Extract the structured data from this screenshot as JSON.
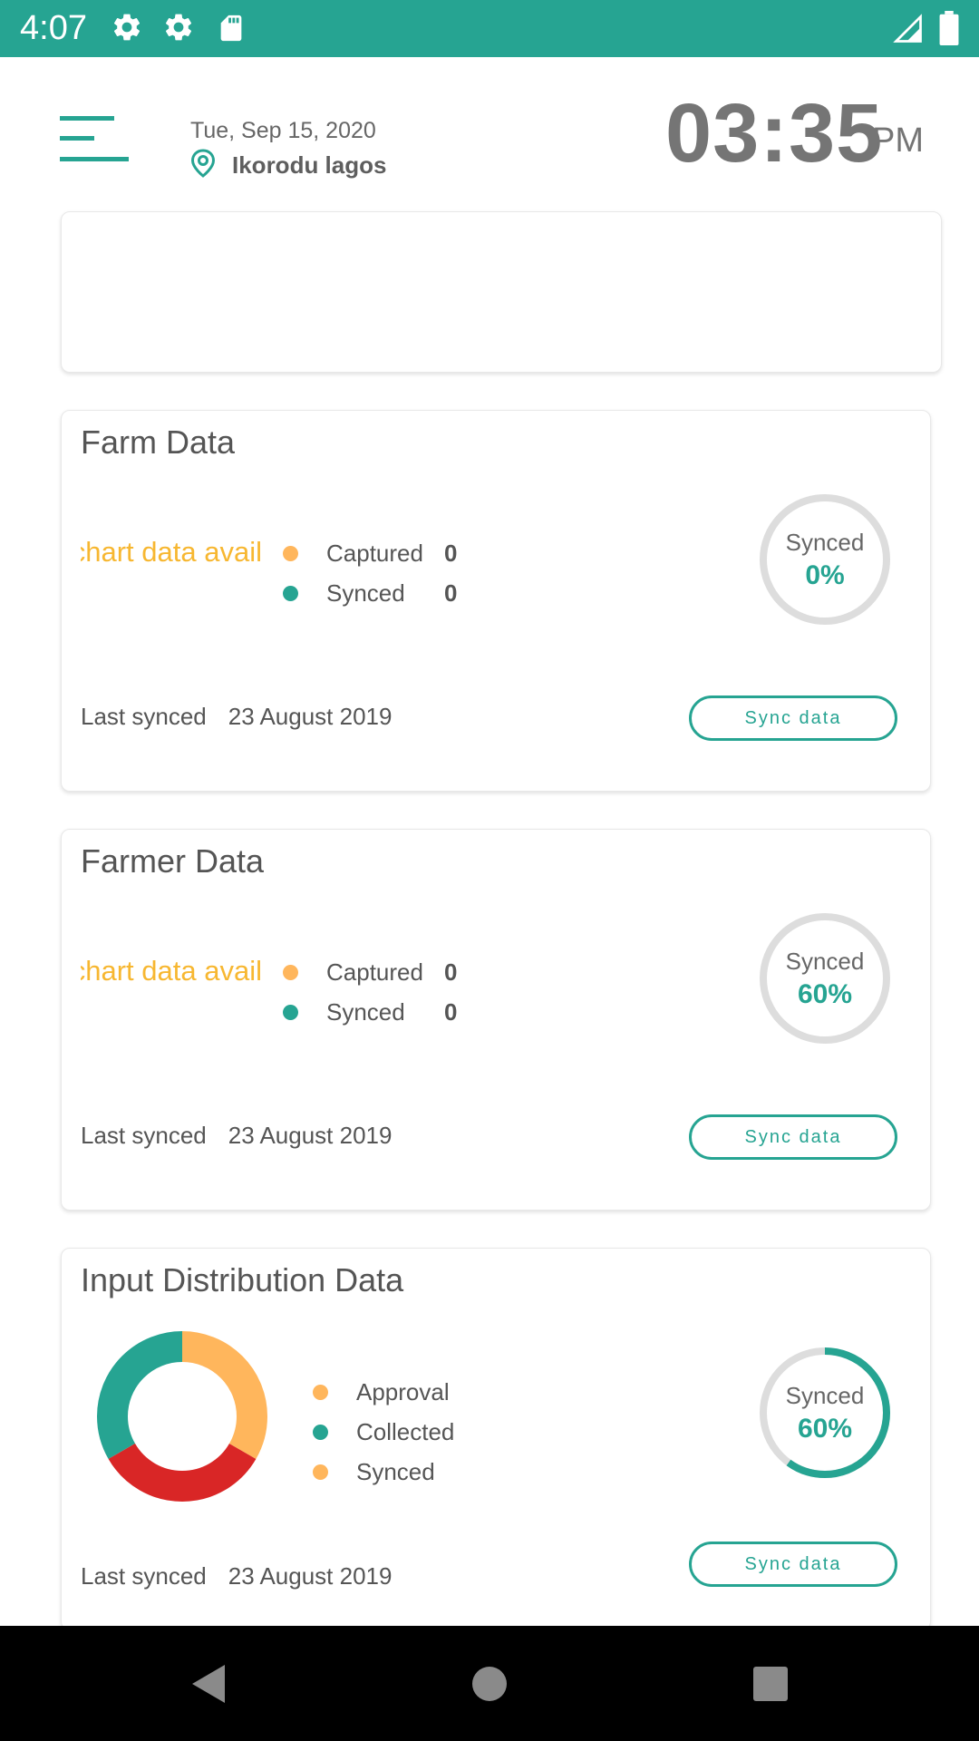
{
  "status_bar": {
    "time": "4:07",
    "icons": [
      "gear-icon",
      "gear-icon",
      "sd-card-icon",
      "signal-icon",
      "battery-icon"
    ]
  },
  "header": {
    "menu_icon": "menu-icon",
    "date": "Tue, Sep 15, 2020",
    "location": "Ikorodu lagos",
    "clock_time": "03:35",
    "clock_ampm": "PM"
  },
  "colors": {
    "primary": "#26a492",
    "captured": "#ffb65c",
    "no_data": "#f7b731",
    "donut_red": "#d92626",
    "ring_track": "#dddddd"
  },
  "cards": {
    "farm": {
      "title": "Farm Data",
      "no_data": "No chart data avail",
      "captured_label": "Captured",
      "captured_value": "0",
      "synced_label": "Synced",
      "synced_value": "0",
      "ring_label": "Synced",
      "ring_value": "0%",
      "synced_fraction": 0,
      "last_synced_label": "Last synced",
      "last_synced_date": "23 August 2019",
      "button": "Sync data"
    },
    "farmer": {
      "title": "Farmer Data",
      "no_data": "No chart data avail",
      "captured_label": "Captured",
      "captured_value": "0",
      "synced_label": "Synced",
      "synced_value": "0",
      "ring_label": "Synced",
      "ring_value": "60%",
      "synced_fraction": 0,
      "last_synced_label": "Last synced",
      "last_synced_date": "23 August 2019",
      "button": "Sync data"
    },
    "input": {
      "title": "Input Distribution Data",
      "legend": [
        {
          "label": "Approval",
          "color": "#ffb65c"
        },
        {
          "label": "Collected",
          "color": "#26a492"
        },
        {
          "label": "Synced",
          "color": "#ffb65c"
        }
      ],
      "donut_fractions": [
        0.3333,
        0.3333,
        0.3333
      ],
      "donut_colors": [
        "#ffb65c",
        "#d92626",
        "#26a492"
      ],
      "ring_label": "Synced",
      "ring_value": "60%",
      "synced_fraction": 0.6,
      "last_synced_label": "Last synced",
      "last_synced_date": "23 August 2019",
      "button": "Sync data"
    }
  },
  "nav_bar": {
    "buttons": [
      "back-icon",
      "home-icon",
      "recents-icon"
    ]
  }
}
